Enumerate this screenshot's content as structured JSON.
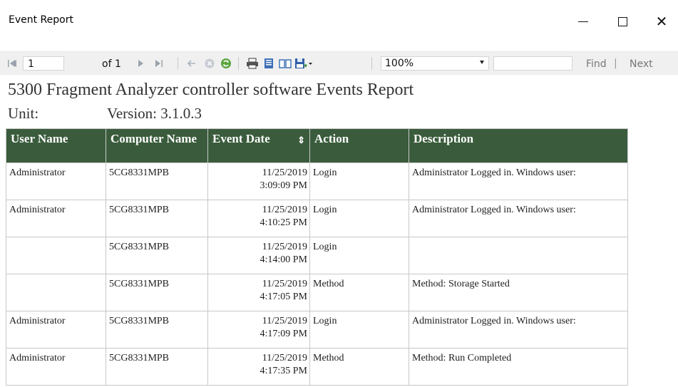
{
  "window": {
    "title": "Event Report",
    "minimize_label": "",
    "maximize_label": "",
    "close_label": "✕"
  },
  "toolbar": {
    "current_page": "1",
    "page_of": "of 1",
    "zoom": "100%",
    "find_label": "Find",
    "find_separator": "|",
    "next_label": "Next",
    "icons": [
      "first-page-icon",
      "prev-page-icon",
      "next-page-icon",
      "last-page-icon",
      "back-icon",
      "stop-icon",
      "refresh-icon",
      "print-icon",
      "print-layout-icon",
      "page-setup-icon",
      "export-icon"
    ]
  },
  "report": {
    "title": "5300 Fragment Analyzer controller software Events Report",
    "unit_label": "Unit:",
    "version_label": "Version: 3.1.0.3",
    "columns": [
      "User Name",
      "Computer Name",
      "Event Date",
      "Action",
      "Description"
    ],
    "rows": [
      {
        "user": "Administrator",
        "computer": "5CG8331MPB",
        "date": "11/25/2019",
        "time": "3:09:09 PM",
        "action": "Login",
        "description": "Administrator Logged in. Windows user:"
      },
      {
        "user": "Administrator",
        "computer": "5CG8331MPB",
        "date": "11/25/2019",
        "time": "4:10:25 PM",
        "action": "Login",
        "description": "Administrator Logged in. Windows user:"
      },
      {
        "user": "",
        "computer": "5CG8331MPB",
        "date": "11/25/2019",
        "time": "4:14:00 PM",
        "action": "Login",
        "description": ""
      },
      {
        "user": "",
        "computer": "5CG8331MPB",
        "date": "11/25/2019",
        "time": "4:17:05 PM",
        "action": "Method",
        "description": "Method: Storage Started"
      },
      {
        "user": "Administrator",
        "computer": "5CG8331MPB",
        "date": "11/25/2019",
        "time": "4:17:09 PM",
        "action": "Login",
        "description": "Administrator Logged in. Windows user:"
      },
      {
        "user": "Administrator",
        "computer": "5CG8331MPB",
        "date": "11/25/2019",
        "time": "4:17:35 PM",
        "action": "Method",
        "description": "Method: Run Completed"
      }
    ]
  },
  "colors": {
    "header_bg": "#3a5c3c",
    "toolbar_bg": "#f0f0f0"
  }
}
